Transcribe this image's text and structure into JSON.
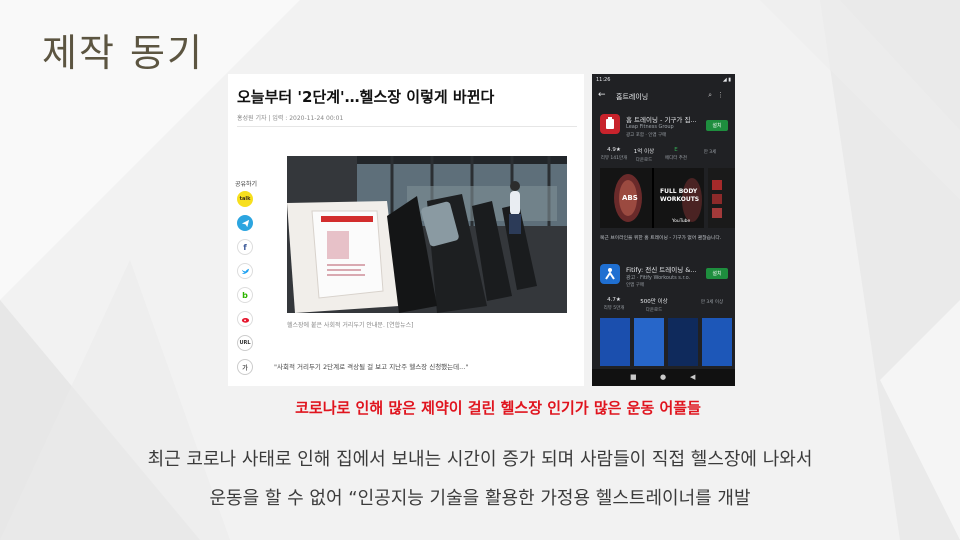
{
  "slide": {
    "title": "제작 동기",
    "caption": "코로나로 인해 많은 제약이 걸린 헬스장  인기가 많은 운동 어플들",
    "body_line_1": "최근 코로나 사태로 인해 집에서 보내는 시간이 증가 되며 사람들이 직접 헬스장에 나와서",
    "body_line_2": "운동을 할 수 없어 “인공지능 기술을 활용한 가정용 헬스트레이너를 개발"
  },
  "article": {
    "headline": "오늘부터 '2단계'…헬스장 이렇게 바뀐다",
    "byline": "홍성원 기자  |  입력 : 2020-11-24 00:01",
    "share_label": "공유하기",
    "share_buttons": [
      "talk",
      "",
      "f",
      "",
      "b",
      "",
      "URL",
      "가"
    ],
    "photo_sign": "사회적거리두기 안내문",
    "photo_caption": "헬스장에 붙은 사회적 거리두기 안내문. [연합뉴스]",
    "quote": "\"사회적 거리두기 2단계로 격상될 걸 보고 지난주 헬스장 신청했는데...\""
  },
  "phone": {
    "status_time": "11:26",
    "status_icons": "◢ ▮",
    "search_query": "홈트레이닝",
    "app1": {
      "name": "홈 트레이닝 - 기구가 집...",
      "developer": "Leap Fitness Group",
      "meta": "광고 포함 · 인앱 구매",
      "install_label": "설치",
      "stats": [
        {
          "value": "4.9★",
          "label": "리뷰 141만개"
        },
        {
          "value": "1억 이상",
          "label": "다운로드"
        },
        {
          "value": "E",
          "label": "에디터 추천"
        },
        {
          "value": "",
          "label": "만 3세"
        }
      ],
      "promo_left": "ABS",
      "promo_right": "FULL BODY WORKOUTS",
      "promo_badge": "YouTube",
      "description": "복근 브이라인을 위한 홈 트레이닝 - 기구가 없어 괜찮습니다."
    },
    "app2": {
      "name": "Fitify: 전신 트레이닝 &...",
      "developer": "광고 · Fitify Workouts s.r.o.",
      "meta": "인앱 구매",
      "install_label": "설치",
      "stats": [
        {
          "value": "4.7★",
          "label": "리뷰 5만개"
        },
        {
          "value": "500만 이상",
          "label": "다운로드"
        },
        {
          "value": "",
          "label": "만 3세 이상"
        }
      ]
    },
    "nav": {
      "square": "■",
      "home": "●",
      "back": "◀"
    }
  },
  "colors": {
    "title": "#5c5541",
    "caption": "#e0141e",
    "install": "#1e8e3e",
    "phone_bg": "#202124"
  }
}
